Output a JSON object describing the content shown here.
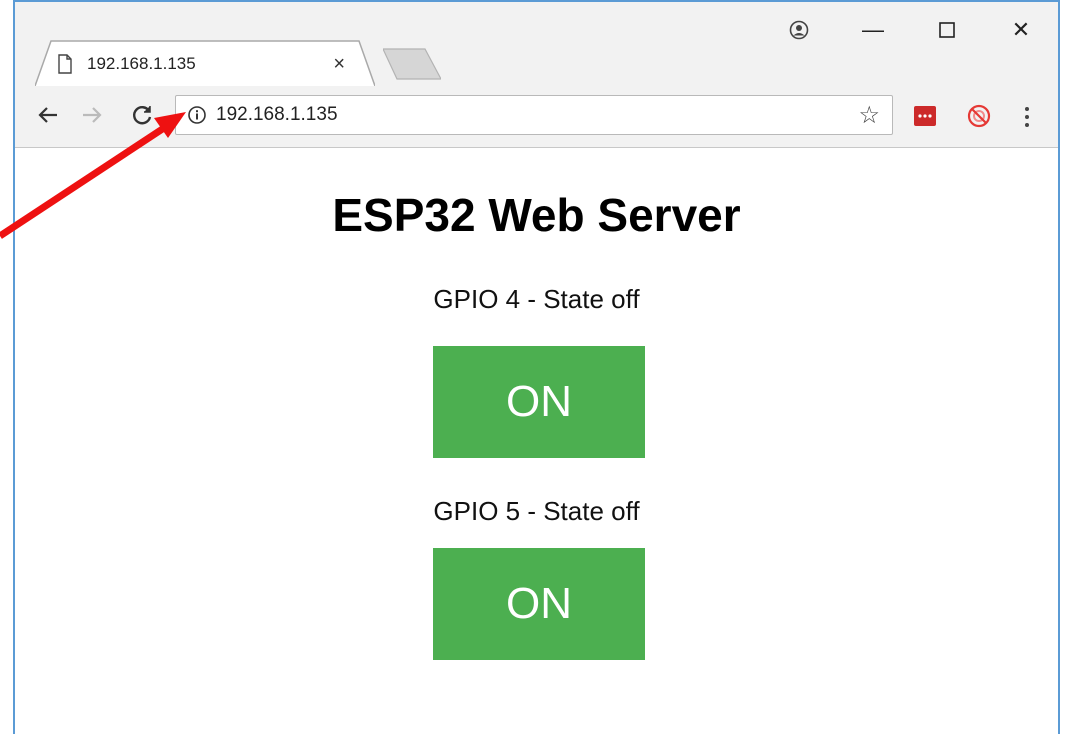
{
  "browser": {
    "tab": {
      "title": "192.168.1.135",
      "close_glyph": "×"
    },
    "window_controls": {
      "profile": "profile-icon",
      "minimize": "—",
      "maximize": "☐",
      "close": "✕"
    },
    "nav": {
      "back": "←",
      "forward": "→",
      "reload": "C"
    },
    "omnibox": {
      "url": "192.168.1.135",
      "info_icon": "info-icon",
      "star": "☆"
    },
    "extensions": [
      {
        "name": "lastpass-icon",
        "color": "#cc2a2a"
      },
      {
        "name": "adblock-icon",
        "color": "#e53935"
      }
    ]
  },
  "page": {
    "title": "ESP32 Web Server",
    "gpios": [
      {
        "label": "GPIO 4 - State off",
        "button_label": "ON"
      },
      {
        "label": "GPIO 5 - State off",
        "button_label": "ON"
      }
    ]
  },
  "colors": {
    "button_green": "#4caf50",
    "arrow_red": "#ee1111",
    "window_border": "#5b9bd5"
  }
}
